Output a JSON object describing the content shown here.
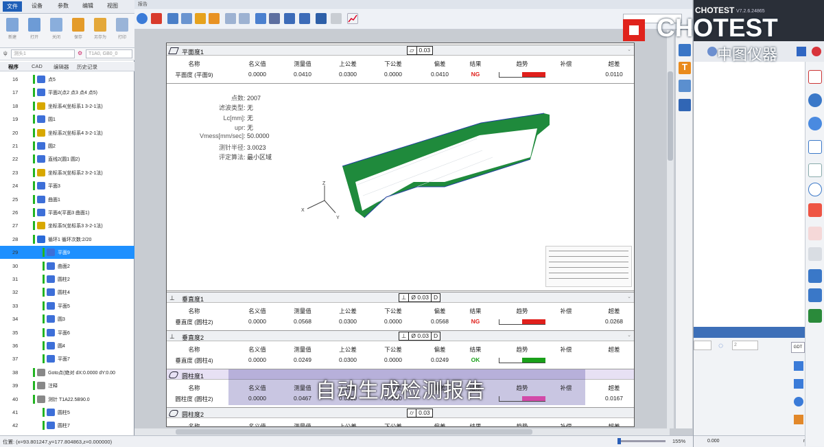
{
  "left": {
    "menu_tabs": [
      "文件",
      "设备",
      "参数",
      "编辑",
      "视图"
    ],
    "ribbon": [
      "新建",
      "打开",
      "关闭",
      "保存",
      "另存为",
      "打印"
    ],
    "select1": "测头1",
    "select2": "T1A0, GB0_0",
    "tabs": [
      "程序",
      "CAD",
      "编辑器",
      "历史记录"
    ],
    "rows": [
      {
        "n": "16",
        "label": "点5",
        "color": "#3d6fd8"
      },
      {
        "n": "17",
        "label": "平面2(点2 点3 点4 点5)",
        "color": "#3d6fd8"
      },
      {
        "n": "18",
        "label": "坐标系4(坐标系1 3-2-1法)",
        "color": "#d8a800"
      },
      {
        "n": "19",
        "label": "圆1",
        "color": "#3d6fd8"
      },
      {
        "n": "20",
        "label": "坐标系2(坐标系4 3-2-1法)",
        "color": "#d8a800"
      },
      {
        "n": "21",
        "label": "圆2",
        "color": "#3d6fd8"
      },
      {
        "n": "22",
        "label": "直线2(圆1 圆2)",
        "color": "#3d6fd8"
      },
      {
        "n": "23",
        "label": "坐标系3(坐标系2 3-2-1法)",
        "color": "#d8a800"
      },
      {
        "n": "24",
        "label": "平面3",
        "color": "#3d6fd8"
      },
      {
        "n": "25",
        "label": "曲面1",
        "color": "#3d6fd8"
      },
      {
        "n": "26",
        "label": "平面4(平面3 曲面1)",
        "color": "#3d6fd8"
      },
      {
        "n": "27",
        "label": "坐标系5(坐标系3 3-2-1法)",
        "color": "#d8a800"
      },
      {
        "n": "28",
        "label": "循环1 循环次数:2/20",
        "color": "#2a6ad8"
      },
      {
        "n": "29",
        "label": "平面9",
        "color": "#3d6fd8"
      },
      {
        "n": "30",
        "label": "曲面2",
        "color": "#3d6fd8"
      },
      {
        "n": "31",
        "label": "圆柱2",
        "color": "#3d6fd8"
      },
      {
        "n": "32",
        "label": "圆柱4",
        "color": "#3d6fd8"
      },
      {
        "n": "33",
        "label": "平面5",
        "color": "#3d6fd8"
      },
      {
        "n": "34",
        "label": "圆3",
        "color": "#3d6fd8"
      },
      {
        "n": "35",
        "label": "平面6",
        "color": "#3d6fd8"
      },
      {
        "n": "36",
        "label": "圆4",
        "color": "#3d6fd8"
      },
      {
        "n": "37",
        "label": "平面7",
        "color": "#3d6fd8"
      },
      {
        "n": "38",
        "label": "Goto点(绝对 dX:0.0000 dY:0.00",
        "color": "#888"
      },
      {
        "n": "39",
        "label": "注释",
        "color": "#888"
      },
      {
        "n": "40",
        "label": "测针 T1A22.5B90.0",
        "color": "#888"
      },
      {
        "n": "41",
        "label": "圆柱5",
        "color": "#3d6fd8"
      },
      {
        "n": "42",
        "label": "圆柱7",
        "color": "#3d6fd8"
      }
    ]
  },
  "report": {
    "window_label": "报告",
    "headers": [
      "名称",
      "名义值",
      "测量值",
      "上公差",
      "下公差",
      "偏差",
      "结果",
      "趋势",
      "补偿",
      "超差"
    ],
    "flatness": {
      "title": "平面度1",
      "fcf": [
        "0.03"
      ],
      "row": [
        "平面度 (平面9)",
        "0.0000",
        "0.0410",
        "0.0300",
        "0.0000",
        "0.0410",
        "NG",
        "",
        "",
        "0.0110"
      ],
      "info": [
        {
          "k": "点数",
          "v": "2007"
        },
        {
          "k": "滤波类型",
          "v": "无"
        },
        {
          "k": "Lc[mm]",
          "v": "无"
        },
        {
          "k": "upr",
          "v": "无"
        },
        {
          "k": "Vmess[mm/sec]",
          "v": "50.0000"
        },
        {
          "k": "测针半径",
          "v": "3.0023"
        },
        {
          "k": "评定算法",
          "v": "最小区域"
        }
      ]
    },
    "perp1": {
      "title": "垂直度1",
      "fcf": [
        "⊥",
        "Ø 0.03",
        "D"
      ],
      "row": [
        "垂直度 (圆柱2)",
        "0.0000",
        "0.0568",
        "0.0300",
        "0.0000",
        "0.0568",
        "NG",
        "",
        "",
        "0.0268"
      ]
    },
    "perp2": {
      "title": "垂直度2",
      "fcf": [
        "⊥",
        "Ø 0.03",
        "D"
      ],
      "row": [
        "垂直度 (圆柱4)",
        "0.0000",
        "0.0249",
        "0.0300",
        "0.0000",
        "0.0249",
        "OK",
        "",
        "",
        ""
      ]
    },
    "cyl1": {
      "title": "圆柱度1",
      "row": [
        "圆柱度 (圆柱2)",
        "0.0000",
        "0.0467",
        "0.0300",
        "0.0000",
        "",
        "",
        "",
        "",
        "0.0167"
      ]
    },
    "cyl2": {
      "title": "圆柱度2",
      "fcf": [
        "0.03"
      ]
    }
  },
  "caption": "自动生成检测报告",
  "logo": {
    "brand": "CHOTEST",
    "cn": "中图仪器",
    "version": "V7.2.6.24865"
  },
  "status": {
    "coords": "位置: (x=93.801247,y=177.804863,z=0.000000)",
    "zoom": "155%",
    "right_val": "0.000",
    "unit": "mm"
  },
  "right": {
    "gdt": "GDT",
    "spin": "2"
  }
}
